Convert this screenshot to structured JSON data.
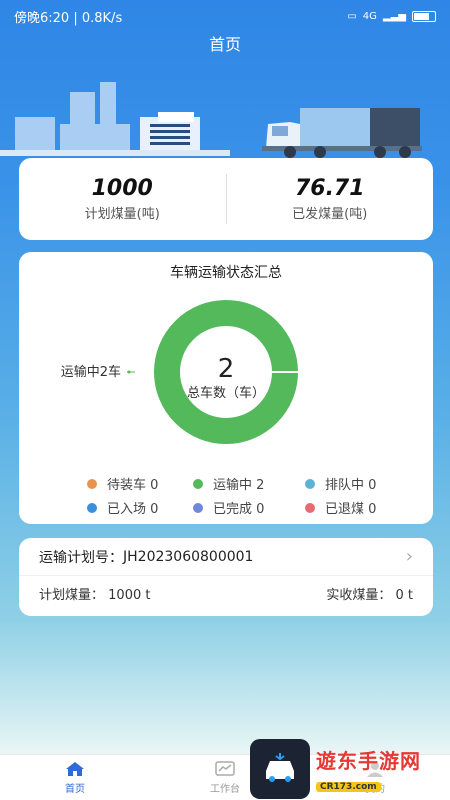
{
  "status": {
    "time": "傍晚6:20",
    "speed": "0.8K/s",
    "network": "4G",
    "battery": "77",
    "battery_level": 0.77
  },
  "header": {
    "title": "首页"
  },
  "stats": {
    "planned_value": "1000",
    "planned_label": "计划煤量(吨)",
    "shipped_value": "76.71",
    "shipped_label": "已发煤量(吨)"
  },
  "chart": {
    "title": "车辆运输状态汇总",
    "callout": "运输中2车",
    "center_value": "2",
    "center_label": "总车数（车）"
  },
  "chart_data": {
    "type": "pie",
    "title": "车辆运输状态汇总",
    "total": 2,
    "series": [
      {
        "name": "待装车",
        "value": 0,
        "color": "#e8944f"
      },
      {
        "name": "运输中",
        "value": 2,
        "color": "#53b95a"
      },
      {
        "name": "排队中",
        "value": 0,
        "color": "#5cb3d6"
      },
      {
        "name": "已入场",
        "value": 0,
        "color": "#3a8fd8"
      },
      {
        "name": "已完成",
        "value": 0,
        "color": "#6f88d9"
      },
      {
        "name": "已退煤",
        "value": 0,
        "color": "#e86b72"
      }
    ],
    "legend_labels": [
      "待装车 0",
      "运输中 2",
      "排队中 0",
      "已入场 0",
      "已完成 0",
      "已退煤 0"
    ]
  },
  "plan": {
    "number_label": "运输计划号：",
    "number_value": "JH2023060800001",
    "planned_label": "计划煤量：",
    "planned_value": "1000 t",
    "received_label": "实收煤量：",
    "received_value": "0 t"
  },
  "tabbar": {
    "home": "首页",
    "workbench": "工作台",
    "mine": "我的"
  },
  "watermark": {
    "text": "遊东手游网",
    "url": "CR173.com"
  },
  "colors": {
    "accent": "#2f6bd8",
    "header_bg": "#2f86e6"
  }
}
